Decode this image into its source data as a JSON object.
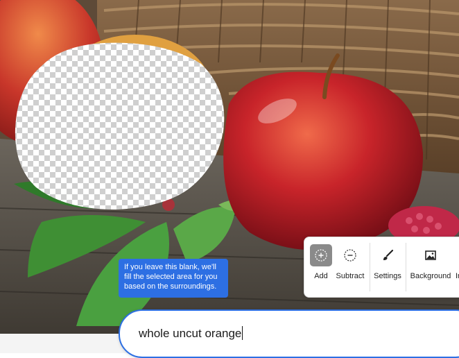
{
  "tooltip": {
    "text": "If you leave this blank, we'll fill the selected area for you based on the surroundings."
  },
  "toolbar": {
    "add_label": "Add",
    "subtract_label": "Subtract",
    "settings_label": "Settings",
    "background_label": "Background",
    "overflow_label": "In"
  },
  "prompt": {
    "value": "whole uncut orange"
  },
  "colors": {
    "accent": "#2d6fe3",
    "active_tool": "#8a8a8a"
  }
}
